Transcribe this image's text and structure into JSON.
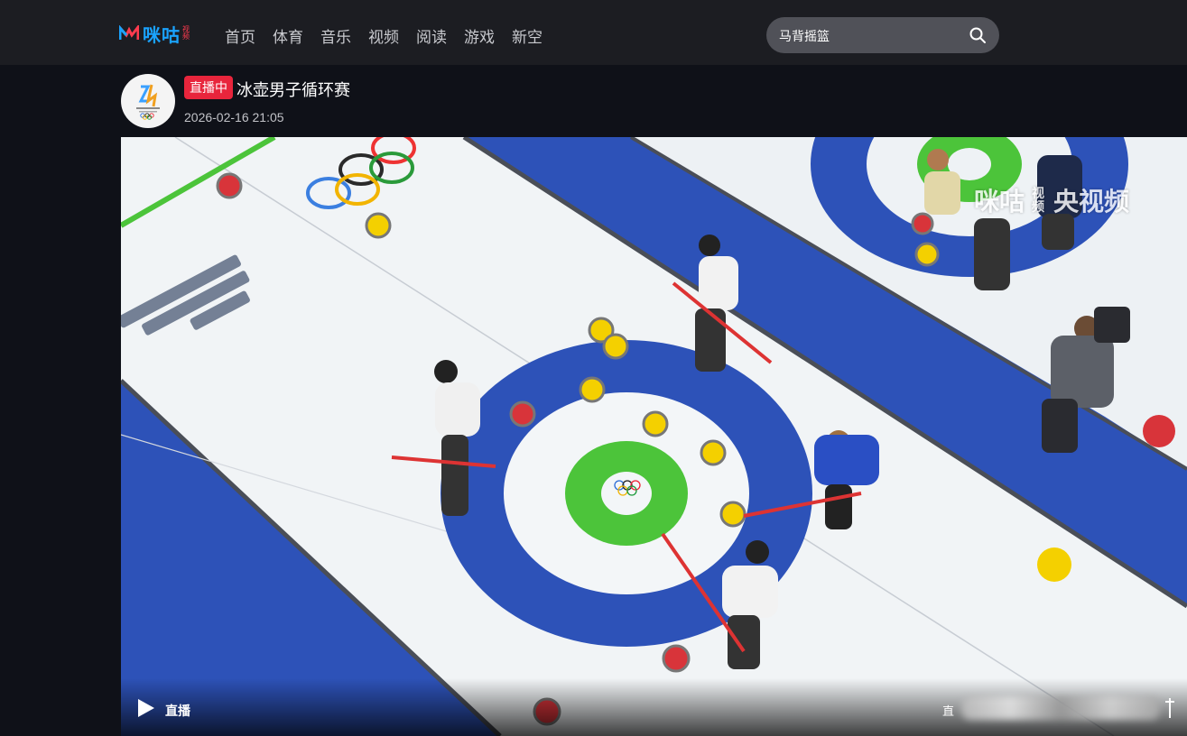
{
  "header": {
    "logo_text": "咪咕",
    "logo_sub": "视频",
    "nav": [
      "首页",
      "体育",
      "音乐",
      "视频",
      "阅读",
      "游戏",
      "新空"
    ],
    "search": {
      "placeholder": "马背摇篮"
    }
  },
  "stream": {
    "badge": "直播中",
    "title": "冰壶男子循环赛",
    "datetime": "2026-02-16 21:05"
  },
  "player": {
    "watermark_brand": "咪咕",
    "watermark_sub": "视频",
    "watermark_partner": "央视频",
    "live_label": "直播",
    "quality_label": "直",
    "icons": {
      "play": "play-icon",
      "search": "search-icon",
      "fullscreen": "fullscreen-icon"
    }
  },
  "colors": {
    "accent_blue": "#1aa3ff",
    "live_red": "#e8253c",
    "ice_blue": "#2d52b8",
    "house_green": "#4cc43a"
  }
}
